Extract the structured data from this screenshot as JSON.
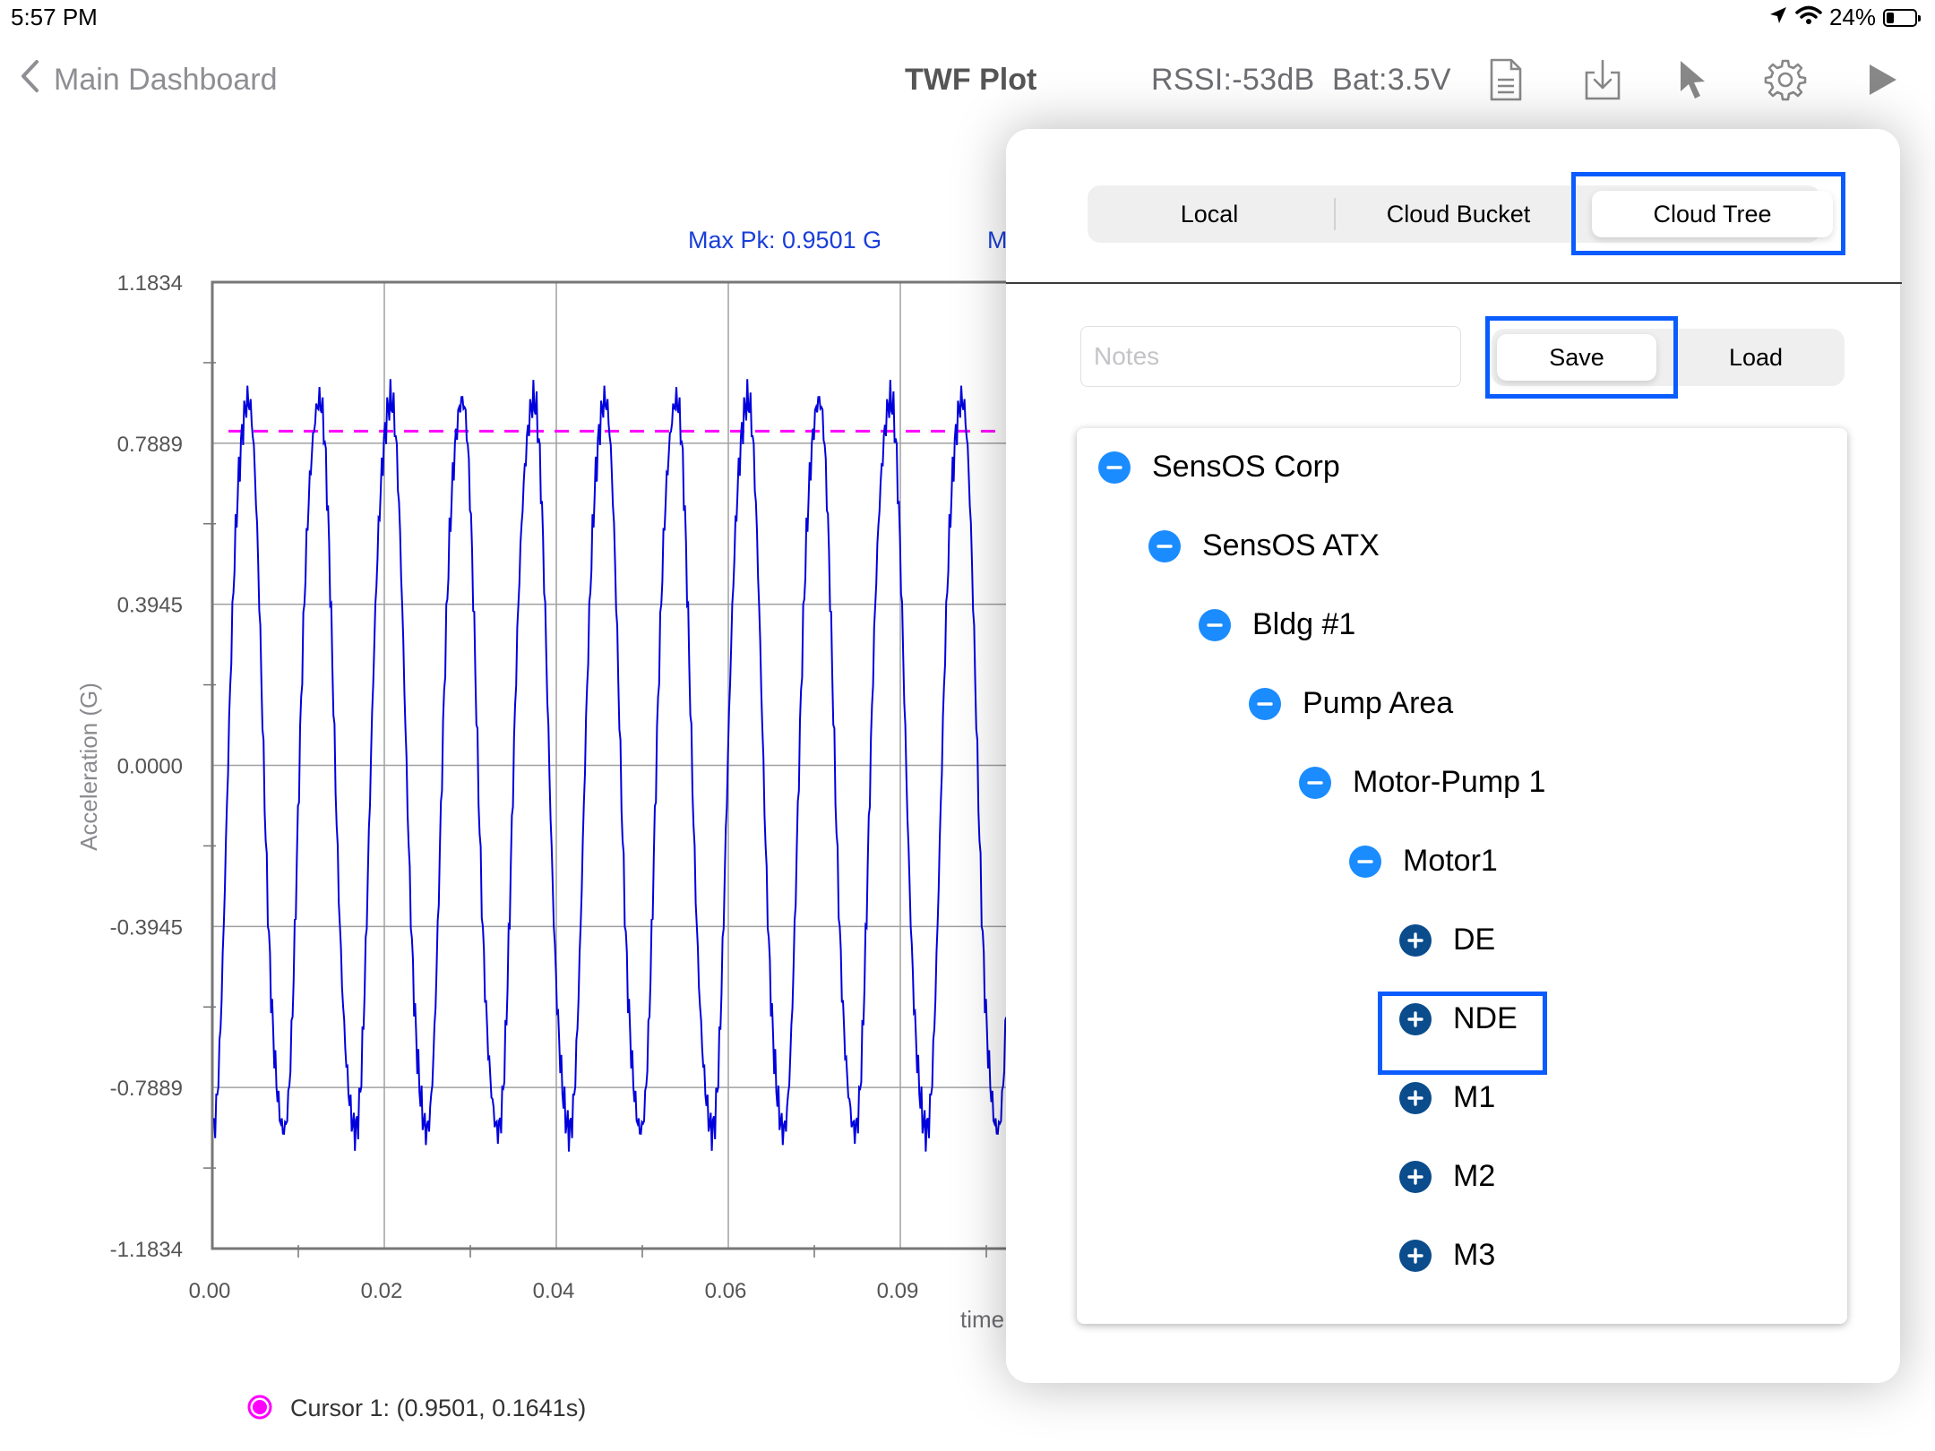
{
  "status_bar": {
    "time": "5:57 PM",
    "battery": "24%"
  },
  "nav": {
    "back_label": "Main Dashboard",
    "title": "TWF Plot",
    "rssi": "RSSI:-53dB",
    "battery": "Bat:3.5V",
    "icons": [
      "document-icon",
      "download-icon",
      "cursor-pointer-icon",
      "gear-icon",
      "play-icon"
    ]
  },
  "chart_header": {
    "max_pk": "Max Pk: 0.9501 G",
    "truncated": "M"
  },
  "chart_data": {
    "type": "line",
    "ylabel": "Acceleration (G)",
    "xlabel": "time",
    "y_ticks": [
      "1.1834",
      "0.7889",
      "0.3945",
      "0.0000",
      "-0.3945",
      "-0.7889",
      "-1.1834"
    ],
    "x_ticks": [
      "0.00",
      "0.02",
      "0.04",
      "0.06",
      "0.09"
    ],
    "ylim": [
      -1.1834,
      1.1834
    ],
    "xlim": [
      0,
      0.1
    ],
    "series": [
      {
        "amplitude": 0.92,
        "period_s": 0.0083,
        "color": "#0000dd"
      }
    ],
    "max_peak_line": {
      "value": 0.9501,
      "color": "#ff00ff"
    },
    "cursor_color": "#ff00ff"
  },
  "cursor_legend": "Cursor 1: (0.9501, 0.1641s)",
  "popover": {
    "tabs": [
      {
        "label": "Local",
        "selected": false
      },
      {
        "label": "Cloud Bucket",
        "selected": false
      },
      {
        "label": "Cloud Tree",
        "selected": true
      }
    ],
    "notes_placeholder": "Notes",
    "save_label": "Save",
    "load_label": "Load",
    "tree": [
      {
        "label": "SensOS Corp",
        "level": 0,
        "icon": "minus"
      },
      {
        "label": "SensOS ATX",
        "level": 1,
        "icon": "minus"
      },
      {
        "label": "Bldg #1",
        "level": 2,
        "icon": "minus"
      },
      {
        "label": "Pump Area",
        "level": 3,
        "icon": "minus"
      },
      {
        "label": "Motor-Pump 1",
        "level": 4,
        "icon": "minus"
      },
      {
        "label": "Motor1",
        "level": 5,
        "icon": "minus"
      },
      {
        "label": "DE",
        "level": 6,
        "icon": "plus"
      },
      {
        "label": "NDE",
        "level": 6,
        "icon": "plus",
        "highlighted": true
      },
      {
        "label": "M1",
        "level": 6,
        "icon": "plus"
      },
      {
        "label": "M2",
        "level": 6,
        "icon": "plus"
      },
      {
        "label": "M3",
        "level": 6,
        "icon": "plus"
      }
    ],
    "highlight_color": "#0a5cff"
  }
}
